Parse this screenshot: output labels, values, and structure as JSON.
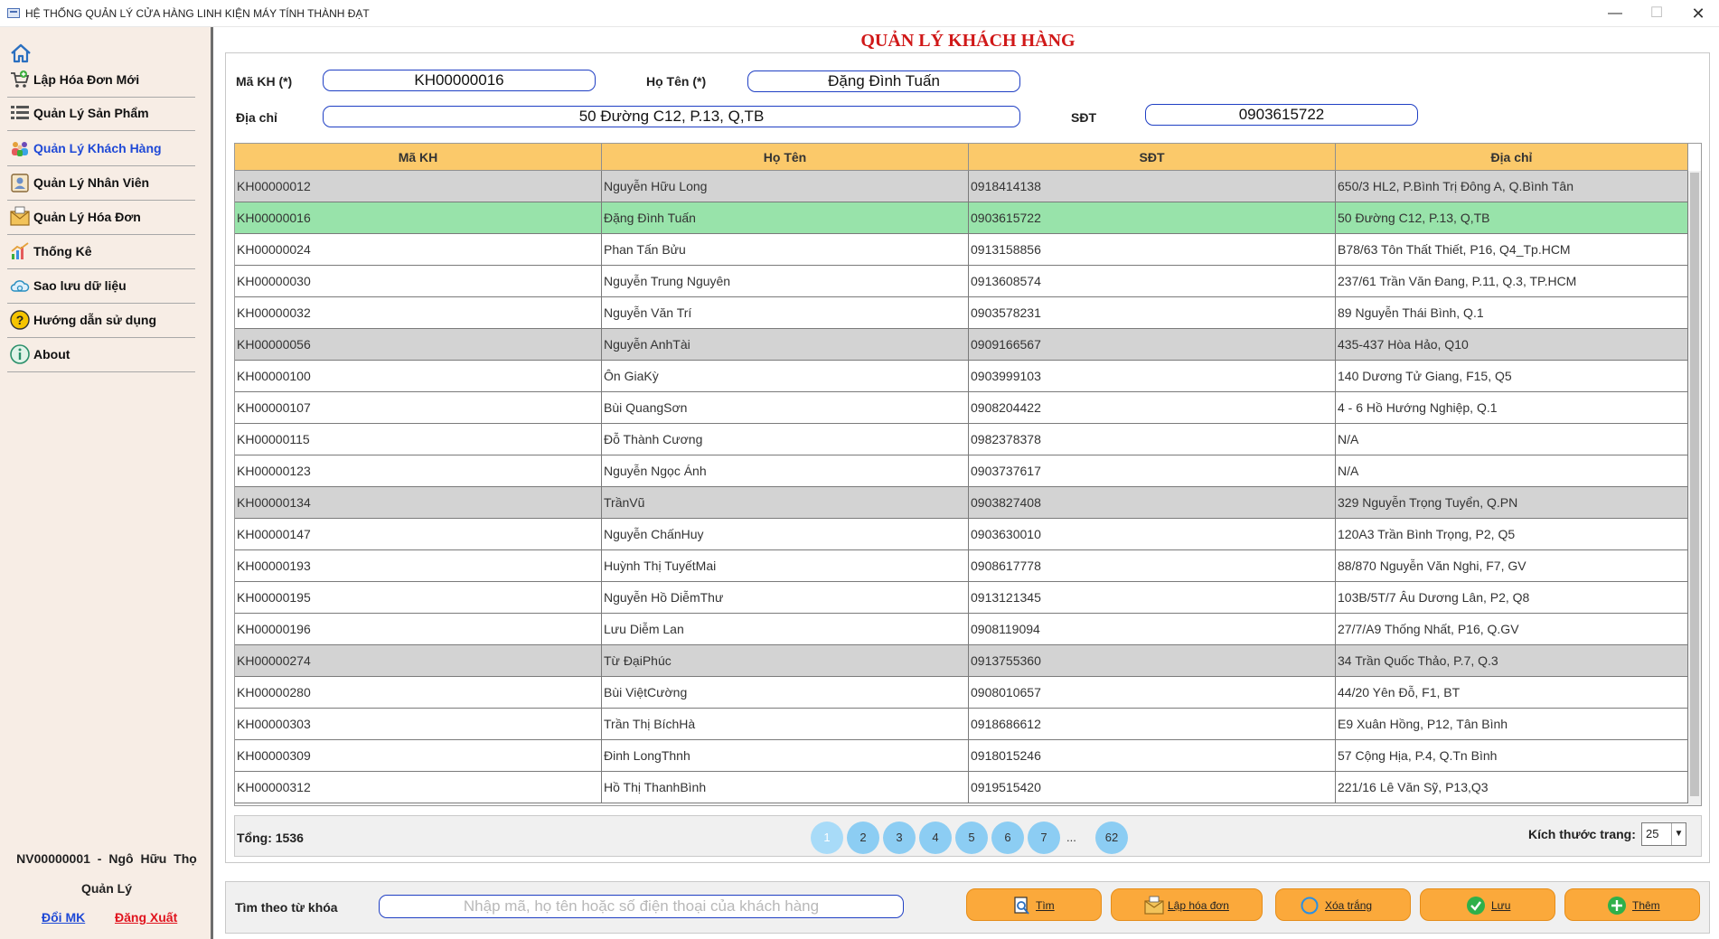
{
  "window": {
    "title": "HỆ THỐNG QUẢN LÝ CỬA HÀNG LINH KIỆN MÁY TÍNH THÀNH ĐẠT",
    "icons": {
      "minimize": "minimize-icon",
      "maximize": "maximize-icon",
      "close": "close-icon"
    }
  },
  "sidebar": {
    "home_icon": "home-icon",
    "items": [
      {
        "label": "Lập Hóa Đơn Mới",
        "icon": "cart-add-icon",
        "active": false
      },
      {
        "label": "Quản Lý Sản Phẩm",
        "icon": "list-icon",
        "active": false
      },
      {
        "label": "Quản Lý Khách Hàng",
        "icon": "users-group-icon",
        "active": true
      },
      {
        "label": "Quản Lý Nhân Viên",
        "icon": "employee-icon",
        "active": false
      },
      {
        "label": "Quản Lý Hóa Đơn",
        "icon": "bill-envelope-icon",
        "active": false
      },
      {
        "label": "Thống Kê",
        "icon": "chart-icon",
        "active": false
      },
      {
        "label": "Sao lưu dữ liệu",
        "icon": "cloud-backup-icon",
        "active": false
      },
      {
        "label": "Hướng dẫn sử dụng",
        "icon": "help-icon",
        "active": false
      },
      {
        "label": "About",
        "icon": "info-icon",
        "active": false
      }
    ],
    "user": {
      "info": "NV00000001 - Ngô Hữu  Thọ",
      "role": "Quản Lý"
    },
    "links": {
      "change_password": "Đổi MK",
      "logout": "Đăng Xuất"
    }
  },
  "page_title": "QUẢN LÝ KHÁCH HÀNG",
  "form": {
    "ma_kh": {
      "label": "Mã KH (*)",
      "value": "KH00000016"
    },
    "ho_ten": {
      "label": "Họ Tên (*)",
      "value": "Đặng Đình Tuấn"
    },
    "dia_chi": {
      "label": "Địa chỉ",
      "value": "50 Đường C12, P.13, Q,TB"
    },
    "sdt": {
      "label": "SĐT",
      "value": "0903615722"
    }
  },
  "table": {
    "columns": [
      "Mã KH",
      "Họ Tên",
      "SĐT",
      "Địa chỉ"
    ],
    "selected_index": 1,
    "rows": [
      {
        "ma": "KH00000012",
        "ten": "Nguyễn Hữu Long",
        "sdt": "0918414138",
        "diachi": "650/3 HL2, P.Bình Trị Đông A, Q.Bình Tân",
        "shade": "alt"
      },
      {
        "ma": "KH00000016",
        "ten": "Đặng Đình Tuấn",
        "sdt": "0903615722",
        "diachi": "50 Đường C12, P.13, Q,TB",
        "shade": "sel"
      },
      {
        "ma": "KH00000024",
        "ten": "Phan Tấn Bửu",
        "sdt": "0913158856",
        "diachi": "B78/63 Tôn Thất Thiết, P16, Q4_Tp.HCM",
        "shade": ""
      },
      {
        "ma": "KH00000030",
        "ten": "Nguyễn Trung Nguyên",
        "sdt": "0913608574",
        "diachi": "237/61 Trần Văn Đang, P.11, Q.3, TP.HCM",
        "shade": ""
      },
      {
        "ma": "KH00000032",
        "ten": "Nguyễn Văn Trí",
        "sdt": "0903578231",
        "diachi": "89 Nguyễn Thái Bình, Q.1",
        "shade": ""
      },
      {
        "ma": "KH00000056",
        "ten": "Nguyễn AnhTài",
        "sdt": "0909166567",
        "diachi": "435-437 Hòa Hảo, Q10",
        "shade": "alt"
      },
      {
        "ma": "KH00000100",
        "ten": "Ôn GiaKỳ",
        "sdt": "0903999103",
        "diachi": "140 Dương Tử Giang, F15, Q5",
        "shade": ""
      },
      {
        "ma": "KH00000107",
        "ten": "Bùi QuangSơn",
        "sdt": "0908204422",
        "diachi": "4 - 6 Hồ Hướng Nghiệp, Q.1",
        "shade": ""
      },
      {
        "ma": "KH00000115",
        "ten": "Đỗ Thành Cương",
        "sdt": "0982378378",
        "diachi": "N/A",
        "shade": ""
      },
      {
        "ma": "KH00000123",
        "ten": "Nguyễn Ngọc Ánh",
        "sdt": "0903737617",
        "diachi": "N/A",
        "shade": ""
      },
      {
        "ma": "KH00000134",
        "ten": "TrầnVũ",
        "sdt": "0903827408",
        "diachi": "329 Nguyễn Trọng Tuyển, Q.PN",
        "shade": "alt"
      },
      {
        "ma": "KH00000147",
        "ten": "Nguyễn ChấnHuy",
        "sdt": "0903630010",
        "diachi": "120A3 Trần Bình Trọng, P2, Q5",
        "shade": ""
      },
      {
        "ma": "KH00000193",
        "ten": "Huỳnh Thị TuyếtMai",
        "sdt": "0908617778",
        "diachi": "88/870 Nguyễn Văn Nghi, F7, GV",
        "shade": ""
      },
      {
        "ma": "KH00000195",
        "ten": "Nguyễn Hồ DiễmThư",
        "sdt": "0913121345",
        "diachi": "103B/5T/7 Âu Dương Lân, P2, Q8",
        "shade": ""
      },
      {
        "ma": "KH00000196",
        "ten": "Lưu Diễm Lan",
        "sdt": "0908119094",
        "diachi": "27/7/A9 Thống Nhất, P16, Q.GV",
        "shade": ""
      },
      {
        "ma": "KH00000274",
        "ten": "Từ ĐạiPhúc",
        "sdt": "0913755360",
        "diachi": "34 Trần Quốc Thảo, P.7, Q.3",
        "shade": "alt"
      },
      {
        "ma": "KH00000280",
        "ten": "Bùi ViệtCường",
        "sdt": "0908010657",
        "diachi": "44/20 Yên Đỗ, F1, BT",
        "shade": ""
      },
      {
        "ma": "KH00000303",
        "ten": "Trần Thị BíchHà",
        "sdt": "0918686612",
        "diachi": "E9 Xuân Hồng, P12, Tân Bình",
        "shade": ""
      },
      {
        "ma": "KH00000309",
        "ten": "Đinh LongThnh",
        "sdt": "0918015246",
        "diachi": "57 Cộng Hịa, P.4, Q.Tn Bình",
        "shade": ""
      },
      {
        "ma": "KH00000312",
        "ten": "Hồ Thị ThanhBình",
        "sdt": "0919515420",
        "diachi": "221/16 Lê Văn Sỹ, P13,Q3",
        "shade": ""
      }
    ]
  },
  "pager": {
    "total_label": "Tổng: 1536",
    "pages": [
      "1",
      "2",
      "3",
      "4",
      "5",
      "6",
      "7"
    ],
    "current": "1",
    "ellipsis": "...",
    "last_page": "62",
    "page_size_label": "Kích thước trang:",
    "page_size": "25"
  },
  "search": {
    "label": "Tìm theo từ khóa",
    "placeholder": "Nhập mã, họ tên hoặc số điện thoại của khách hàng",
    "value": ""
  },
  "actions": [
    {
      "label": "Tìm",
      "icon": "search-doc-icon"
    },
    {
      "label": "Lập hóa đơn",
      "icon": "bill-envelope-icon"
    },
    {
      "label": "Xóa trắng",
      "icon": "clear-circle-icon"
    },
    {
      "label": "Lưu",
      "icon": "check-save-icon"
    },
    {
      "label": "Thêm",
      "icon": "plus-add-icon"
    }
  ],
  "colors": {
    "title_red": "#d01818",
    "active_nav": "#1f49d6",
    "table_header": "#fbc96a",
    "row_selected": "#98e3aa",
    "row_alt": "#d3d3d3",
    "page_button": "#8ccdf3",
    "action_button": "#fba93b"
  }
}
